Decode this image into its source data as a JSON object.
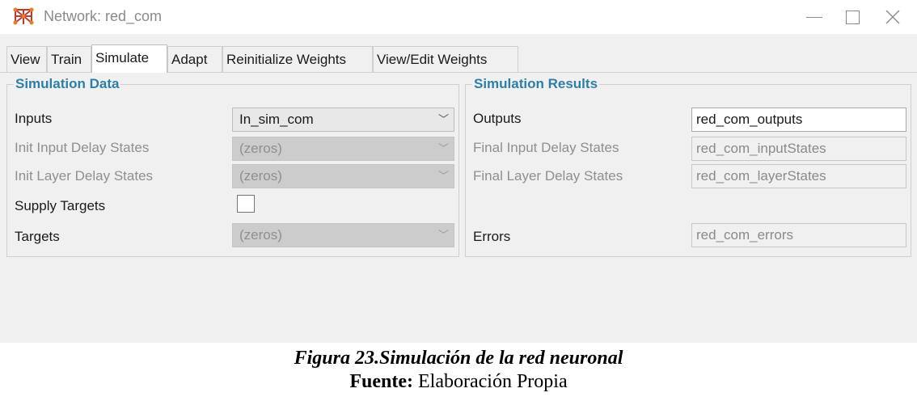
{
  "window": {
    "title": "Network: red_com",
    "icon": "network-app-icon",
    "controls": {
      "minimize": "minimize-icon",
      "maximize": "maximize-icon",
      "close": "close-icon"
    }
  },
  "tabs": [
    "View",
    "Train",
    "Simulate",
    "Adapt",
    "Reinitialize Weights",
    "View/Edit Weights"
  ],
  "active_tab": "Simulate",
  "simulation_data": {
    "title": "Simulation Data",
    "inputs_label": "Inputs",
    "inputs_value": "In_sim_com",
    "init_input_delay_label": "Init Input Delay States",
    "init_input_delay_value": "(zeros)",
    "init_layer_delay_label": "Init Layer Delay States",
    "init_layer_delay_value": "(zeros)",
    "supply_targets_label": "Supply Targets",
    "supply_targets_checked": false,
    "targets_label": "Targets",
    "targets_value": "(zeros)"
  },
  "simulation_results": {
    "title": "Simulation Results",
    "outputs_label": "Outputs",
    "outputs_value": "red_com_outputs",
    "final_input_delay_label": "Final Input Delay States",
    "final_input_delay_value": "red_com_inputStates",
    "final_layer_delay_label": "Final Layer Delay States",
    "final_layer_delay_value": "red_com_layerStates",
    "errors_label": "Errors",
    "errors_value": "red_com_errors"
  },
  "caption": {
    "figure": "Figura 23.Simulación de la red neuronal",
    "source_label": "Fuente:",
    "source_text": " Elaboración Propia"
  },
  "colors": {
    "group_title": "#2d7fa8",
    "window_bg": "#f0f0f0"
  }
}
